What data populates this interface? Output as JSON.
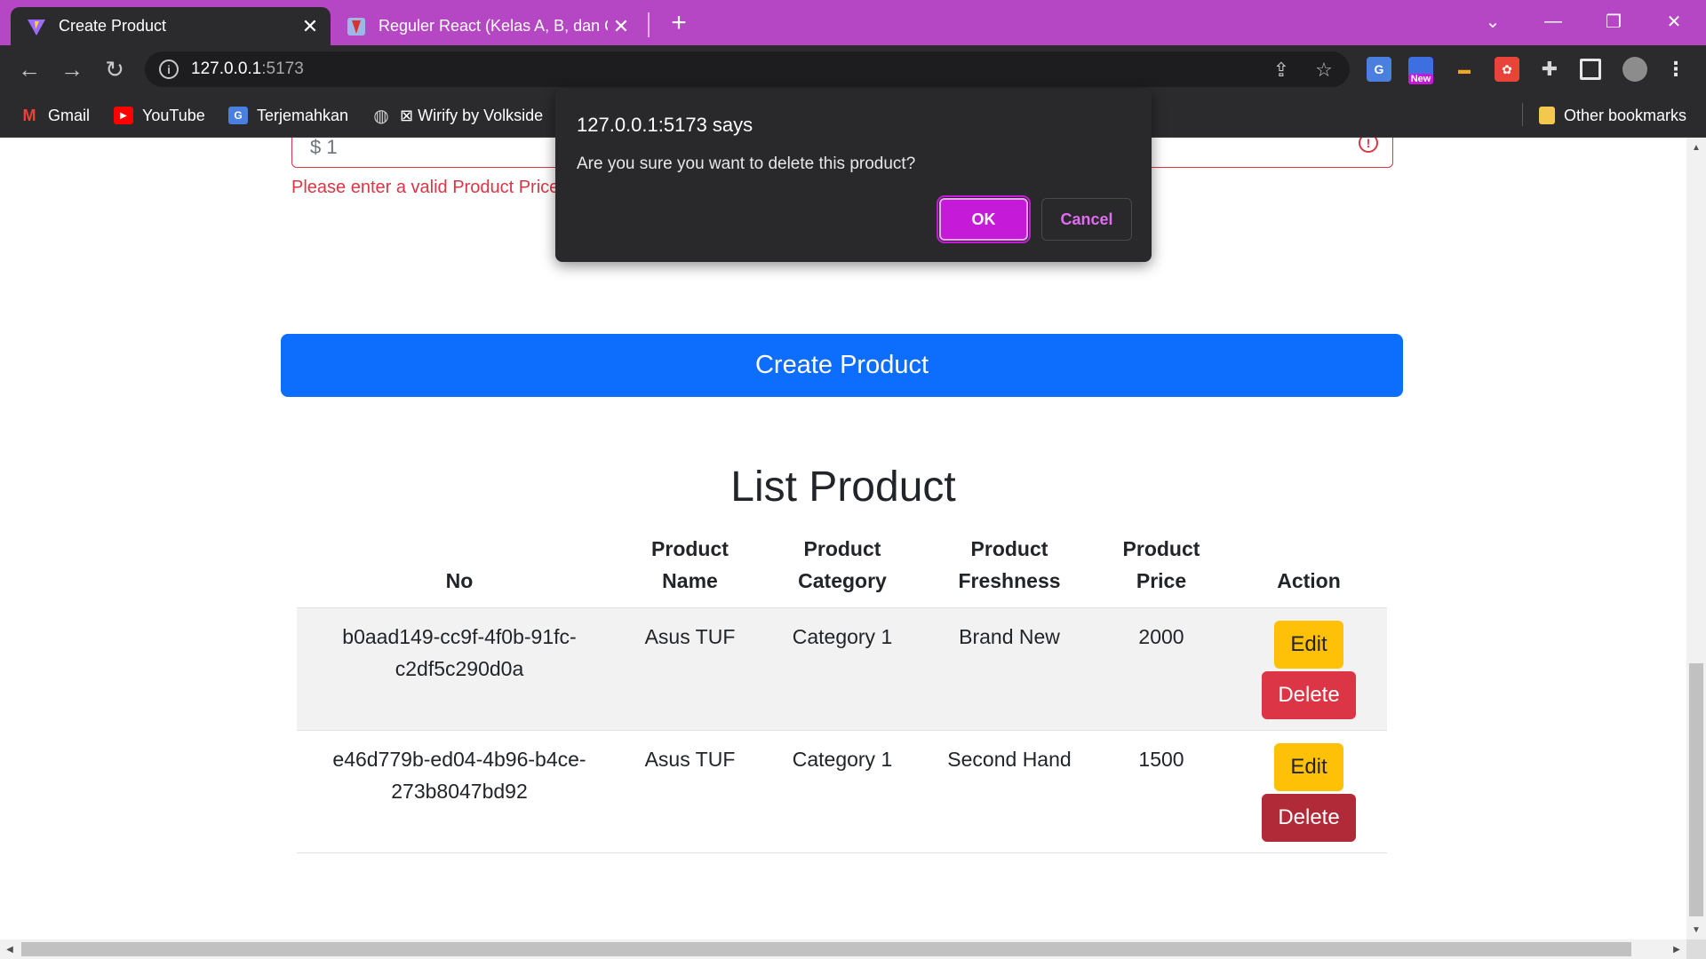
{
  "browser": {
    "tabs": [
      {
        "title": "Create Product",
        "icon": "vite-icon",
        "active": true
      },
      {
        "title": "Reguler React (Kelas A, B, dan C)",
        "icon": "course-icon",
        "active": false
      }
    ],
    "url_host": "127.0.0.1",
    "url_port": ":5173",
    "extensions": [
      {
        "name": "google-translate-icon",
        "badge": "G"
      },
      {
        "name": "new-extension-icon",
        "badge": "New"
      }
    ],
    "bookmarks": [
      {
        "label": "Gmail",
        "icon": "gmail-icon"
      },
      {
        "label": "YouTube",
        "icon": "youtube-icon"
      },
      {
        "label": "Terjemahkan",
        "icon": "translate-icon"
      },
      {
        "label": "⊠ Wirify by Volkside",
        "icon": "globe-icon"
      }
    ],
    "other_bookmarks": "Other bookmarks"
  },
  "form": {
    "price_value": "$ 1",
    "price_error": "Please enter a valid Product Price"
  },
  "create_button": "Create Product",
  "list": {
    "title": "List Product",
    "headers": [
      "No",
      "Product Name",
      "Product Category",
      "Product Freshness",
      "Product Price",
      "Action"
    ],
    "rows": [
      {
        "no": "b0aad149-cc9f-4f0b-91fc-c2df5c290d0a",
        "name": "Asus TUF",
        "category": "Category 1",
        "freshness": "Brand New",
        "price": "2000"
      },
      {
        "no": "e46d779b-ed04-4b96-b4ce-273b8047bd92",
        "name": "Asus TUF",
        "category": "Category 1",
        "freshness": "Second Hand",
        "price": "1500"
      }
    ],
    "edit_label": "Edit",
    "delete_label": "Delete"
  },
  "dialog": {
    "title": "127.0.0.1:5173 says",
    "message": "Are you sure you want to delete this product?",
    "ok": "OK",
    "cancel": "Cancel"
  },
  "colors": {
    "tabstrip": "#b547c4",
    "primary": "#0d6efd",
    "warning": "#ffc107",
    "danger": "#dc3545",
    "dialog_accent": "#c51bd8"
  }
}
